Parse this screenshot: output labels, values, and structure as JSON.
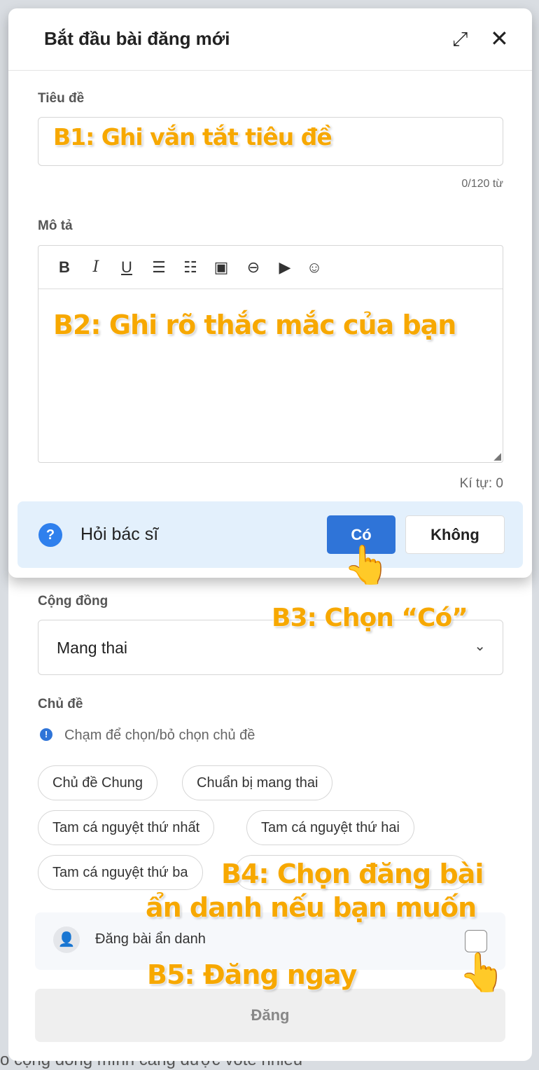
{
  "modal": {
    "title": "Bắt đầu bài đăng mới",
    "expand_icon": "expand-icon",
    "close_icon": "close-icon"
  },
  "title_field": {
    "label": "Tiêu đề",
    "counter": "0/120 từ",
    "value": ""
  },
  "description": {
    "label": "Mô tả",
    "toolbar": [
      "bold",
      "italic",
      "underline",
      "ordered-list",
      "bullet-list",
      "image",
      "link",
      "video",
      "emoji"
    ],
    "char_count": "Kí tự: 0"
  },
  "ask_doctor": {
    "label": "Hỏi bác sĩ",
    "yes": "Có",
    "no": "Không"
  },
  "community": {
    "label": "Cộng đồng",
    "value": "Mang thai"
  },
  "topic": {
    "label": "Chủ đề",
    "hint": "Chạm để chọn/bỏ chọn chủ đề",
    "chips": [
      "Chủ đề Chung",
      "Chuẩn bị mang thai",
      "Tam cá nguyệt thứ nhất",
      "Tam cá nguyệt thứ hai",
      "Tam cá nguyệt thứ ba"
    ]
  },
  "anonymous": {
    "label": "Đăng bài ẩn danh",
    "checked": false
  },
  "submit": {
    "label": "Đăng"
  },
  "background_text": "o cộng đồng mình càng được vote nhiều",
  "annotations": {
    "b1": "B1: Ghi vắn tắt tiêu đề",
    "b2": "B2: Ghi rõ thắc mắc của bạn",
    "b3": "B3: Chọn “Có”",
    "b4_line1": "B4: Chọn đăng bài",
    "b4_line2": "ẩn danh nếu bạn muốn",
    "b5": "B5: Đăng ngay"
  },
  "colors": {
    "primary": "#2f74d8",
    "annotation": "#f7a800",
    "banner": "#e3f0fc"
  }
}
